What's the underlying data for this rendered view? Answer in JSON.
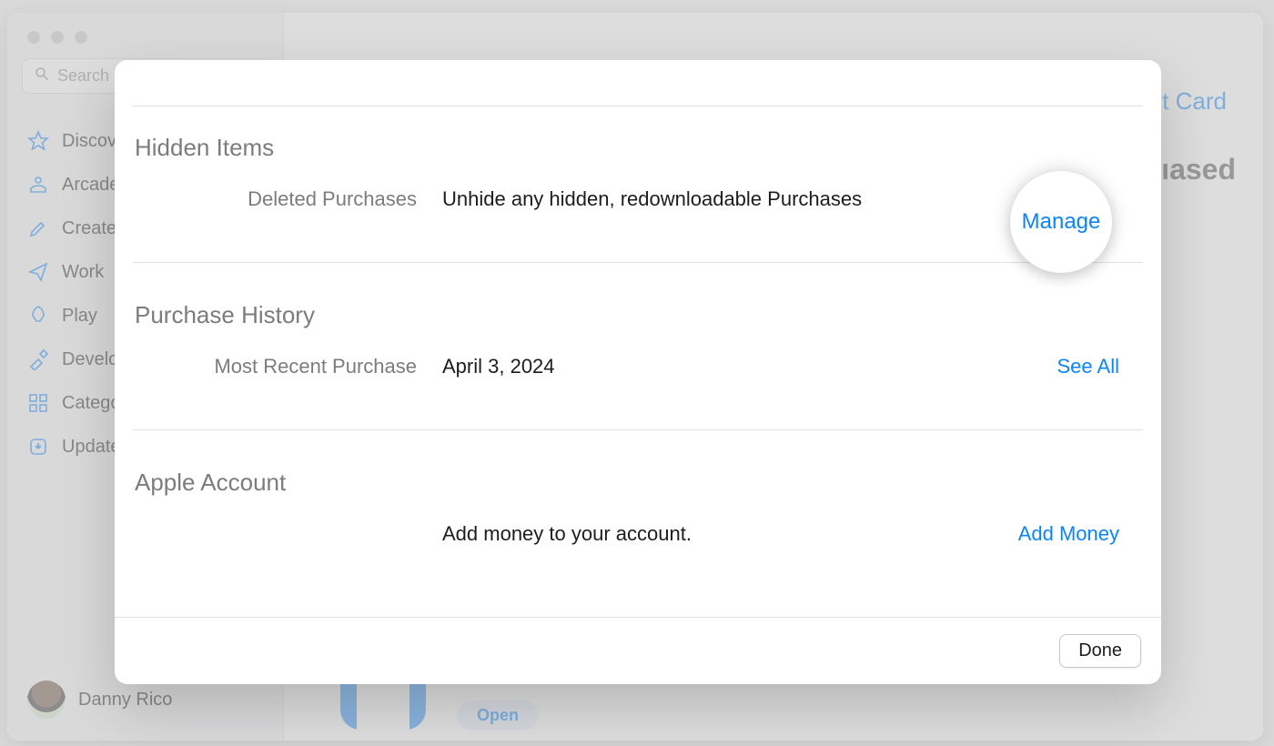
{
  "sidebar": {
    "search_placeholder": "Search",
    "items": [
      {
        "label": "Discover"
      },
      {
        "label": "Arcade"
      },
      {
        "label": "Create"
      },
      {
        "label": "Work"
      },
      {
        "label": "Play"
      },
      {
        "label": "Develop"
      },
      {
        "label": "Categories"
      },
      {
        "label": "Updates"
      }
    ],
    "user_name": "Danny Rico"
  },
  "main": {
    "top_link_fragment": "t Card",
    "right_label_fragment": "ıased",
    "open_label": "Open"
  },
  "sheet": {
    "sections": {
      "hidden": {
        "title": "Hidden Items",
        "row_label": "Deleted Purchases",
        "row_value": "Unhide any hidden, redownloadable Purchases",
        "action": "Manage"
      },
      "history": {
        "title": "Purchase History",
        "row_label": "Most Recent Purchase",
        "row_value": "April 3, 2024",
        "action": "See All"
      },
      "account": {
        "title": "Apple Account",
        "row_label": "",
        "row_value": "Add money to your account.",
        "action": "Add Money"
      }
    },
    "done_label": "Done"
  }
}
